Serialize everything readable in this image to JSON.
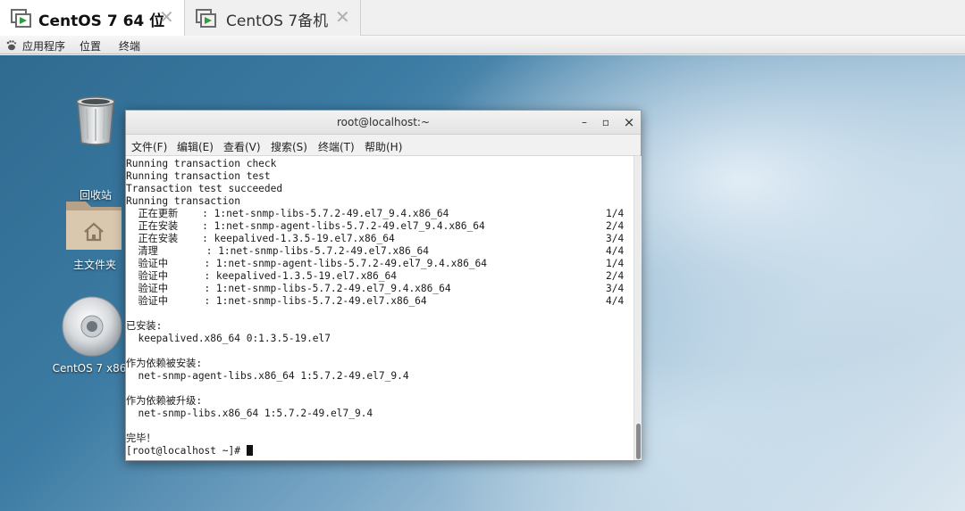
{
  "tabs": [
    {
      "label": "CentOS 7 64 位",
      "active": true,
      "icon": "vm-icon"
    },
    {
      "label": "CentOS 7备机",
      "active": false,
      "icon": "vm-icon"
    }
  ],
  "topbar": {
    "applications": "应用程序",
    "places": "位置",
    "terminal": "终端"
  },
  "desktop": {
    "icons": [
      {
        "label": "回收站",
        "icon": "trash-icon"
      },
      {
        "label": "主文件夹",
        "icon": "home-folder-icon"
      },
      {
        "label": "CentOS 7 x86_",
        "icon": "cdrom-icon"
      }
    ]
  },
  "terminal": {
    "title": "root@localhost:~",
    "controls": {
      "minimize": "–",
      "maximize": "▫",
      "close": "×"
    },
    "menu": [
      "文件(F)",
      "编辑(E)",
      "查看(V)",
      "搜索(S)",
      "终端(T)",
      "帮助(H)"
    ],
    "lines": [
      "Running transaction check",
      "Running transaction test",
      "Transaction test succeeded",
      "Running transaction",
      "  正在更新    : 1:net-snmp-libs-5.7.2-49.el7_9.4.x86_64",
      "  正在安装    : 1:net-snmp-agent-libs-5.7.2-49.el7_9.4.x86_64",
      "  正在安装    : keepalived-1.3.5-19.el7.x86_64",
      "  清理        : 1:net-snmp-libs-5.7.2-49.el7.x86_64",
      "  验证中      : 1:net-snmp-agent-libs-5.7.2-49.el7_9.4.x86_64",
      "  验证中      : keepalived-1.3.5-19.el7.x86_64",
      "  验证中      : 1:net-snmp-libs-5.7.2-49.el7_9.4.x86_64",
      "  验证中      : 1:net-snmp-libs-5.7.2-49.el7.x86_64",
      "",
      "已安装:",
      "  keepalived.x86_64 0:1.3.5-19.el7",
      "",
      "作为依赖被安装:",
      "  net-snmp-agent-libs.x86_64 1:5.7.2-49.el7_9.4",
      "",
      "作为依赖被升级:",
      "  net-snmp-libs.x86_64 1:5.7.2-49.el7_9.4",
      "",
      "完毕！",
      "[root@localhost ~]# "
    ],
    "counts": [
      "1/4",
      "2/4",
      "3/4",
      "4/4",
      "1/4",
      "2/4",
      "3/4",
      "4/4"
    ]
  }
}
